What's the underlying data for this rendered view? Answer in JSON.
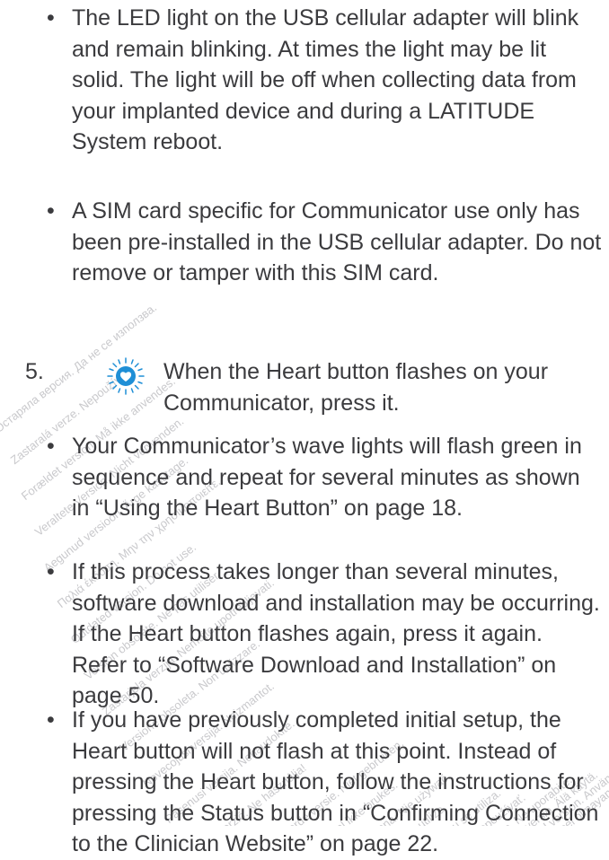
{
  "bullets_top": [
    {
      "marker": "•",
      "text": "The LED light on the USB cellular adapter will blink and remain blinking.  At times the light may be lit solid. The light will be off when collecting data from your implanted device and during a LATITUDE System reboot."
    },
    {
      "marker": "•",
      "text": "A SIM card specific for Communicator use only has been pre-installed in the USB cellular adapter. Do not remove or tamper with this SIM card."
    }
  ],
  "step": {
    "number": "5.",
    "icon": "heart-button-icon",
    "text": "When the Heart button flashes on your Communicator, press it."
  },
  "bullets_bottom": [
    {
      "marker": "•",
      "text": "Your Communicator’s wave lights will flash green in sequence and repeat for several minutes as shown in “Using the Heart Button” on page 18."
    },
    {
      "marker": "•",
      "text": "If this process takes longer than several minutes, software download and installation may be occurring. If the Heart button flashes again, press it again. Refer to “Software Download and Installation” on page 50."
    },
    {
      "marker": "•",
      "text": "If you have previously completed initial setup, the Heart button will not flash at this point. Instead of pressing the Heart button, follow the instructions for pressing the Status button in “Confirming Connection to the Clinician Website” on page 22."
    }
  ],
  "colors": {
    "text": "#3b3b3e",
    "heart_button_blue": "#1f8fd6",
    "watermark": "#c9c9cc"
  },
  "watermark_lines": [
    "Остаряла версия. Да не се използва.",
    "Zastaralá verze. Nepoužívat.",
    "Forældet version. Må ikke anvendes.",
    "Veraltete Version. Nicht verwenden.",
    "Aegunud versioon. Ärge kasutage.",
    "Παλιά έκδοση. Μην την χρησιμοποιείτε.",
    "Outdated version. Do not use.",
    "Version obsolète. Ne pas utiliser.",
    "Zastarjela verzija. Nemojte upotrebljavati.",
    "Versione obsoleta. Non utilizzare.",
    "Novecojusi versija. Neizmantot.",
    "Pasenusi versija. Nenaudokite.",
    "Elavult verzió. Ne használja!",
    "Dit is een verouderde versie. Niet gebruiken.",
    "Utdatert versjon. Skal ikke brukes.",
    "Wersja przeterminowana. Nie używać.",
    "Versão obsoleta. Não utilize.",
    "Versiune expirată. A nu se utiliza.",
    "Zastaraná verzia. Nepoužívať.",
    "Zastarela različica. Ne uporabite.",
    "Vanhentunut versio. Älä käytä.",
    "Föråldrad version. Använd ej.",
    "Güncel olmayan sürüm. Kullanmayın."
  ]
}
